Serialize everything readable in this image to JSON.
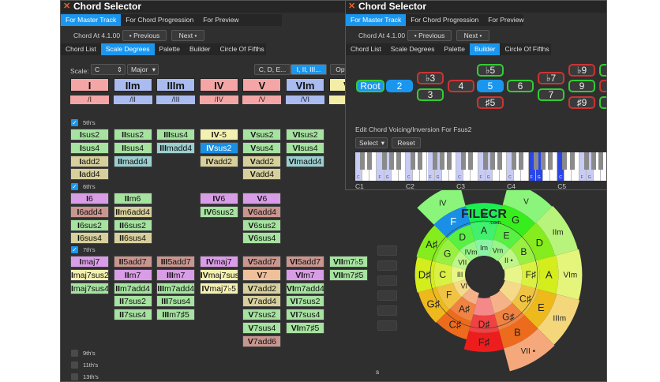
{
  "left_window": {
    "title": "Chord Selector",
    "top_tabs": [
      "For Master Track",
      "For Chord Progression",
      "For Preview"
    ],
    "chord_at": "Chord At 4.1.00",
    "previous": "• Previous",
    "next": "Next •",
    "sub_tabs": [
      "Chord List",
      "Scale Degrees",
      "Palette",
      "Builder",
      "Circle Of Fifths"
    ],
    "active_sub_tab": "Scale Degrees",
    "scale_label": "Scale:",
    "scale_key": "C",
    "scale_mode": "Major",
    "notation": [
      "C, D, E...",
      "I, II, III..."
    ],
    "options": "Opti",
    "degrees": [
      {
        "label": "I",
        "color": "#f4a6a6"
      },
      {
        "label": "IIm",
        "color": "#aabbf0"
      },
      {
        "label": "IIIm",
        "color": "#aabbf0"
      },
      {
        "label": "IV",
        "color": "#f4a6a6"
      },
      {
        "label": "V",
        "color": "#f4a6a6"
      },
      {
        "label": "VIm",
        "color": "#aabbf0"
      },
      {
        "label": "VI",
        "color": "#f2eea6"
      }
    ],
    "slash": [
      "/I",
      "/II",
      "/III",
      "/IV",
      "/V",
      "/VI",
      "/"
    ],
    "sections": [
      {
        "label": "5th's",
        "checked": true,
        "columns": [
          [
            [
              "I",
              "sus2",
              "g"
            ],
            [
              "I",
              "sus4",
              "g"
            ],
            [
              "I",
              "add2",
              "k"
            ],
            [
              "I",
              "add4",
              "k"
            ]
          ],
          [
            [
              "II",
              "sus2",
              "g"
            ],
            [
              "II",
              "sus4",
              "g"
            ],
            [
              "II",
              "madd4",
              "t"
            ]
          ],
          [
            [
              "III",
              "sus4",
              "g"
            ],
            [
              "III",
              "madd4",
              "t"
            ]
          ],
          [
            [
              "IV",
              "-5",
              "y"
            ],
            [
              "IV",
              "sus2",
              "s"
            ],
            [
              "IV",
              "add2",
              "k"
            ]
          ],
          [
            [
              "V",
              "sus2",
              "g"
            ],
            [
              "V",
              "sus4",
              "g"
            ],
            [
              "V",
              "add2",
              "k"
            ],
            [
              "V",
              "add4",
              "k"
            ]
          ],
          [
            [
              "VI",
              "sus2",
              "g"
            ],
            [
              "VI",
              "sus4",
              "g"
            ],
            [
              "VI",
              "madd4",
              "t"
            ]
          ],
          []
        ]
      },
      {
        "label": "6th's",
        "checked": true,
        "columns": [
          [
            [
              "I",
              "6",
              "p"
            ],
            [
              "I",
              "6add4",
              "b"
            ],
            [
              "I",
              "6sus2",
              "g"
            ],
            [
              "I",
              "6sus4",
              "k"
            ]
          ],
          [
            [
              "II",
              "m6",
              "g"
            ],
            [
              "II",
              "m6add4",
              "k"
            ],
            [
              "II",
              "6sus2",
              "g"
            ],
            [
              "II",
              "6sus4",
              "k"
            ]
          ],
          [],
          [
            [
              "IV",
              "6",
              "p"
            ],
            [
              "IV",
              "6sus2",
              "g"
            ]
          ],
          [
            [
              "V",
              "6",
              "p"
            ],
            [
              "V",
              "6add4",
              "b"
            ],
            [
              "V",
              "6sus2",
              "g"
            ],
            [
              "V",
              "6sus4",
              "g"
            ]
          ],
          [],
          []
        ]
      },
      {
        "label": "7th's",
        "checked": true,
        "columns": [
          [
            [
              "I",
              "maj7",
              "p"
            ],
            [
              "I",
              "maj7sus2",
              "y"
            ],
            [
              "I",
              "maj7sus4",
              "g"
            ]
          ],
          [
            [
              "II",
              "5add7",
              "b"
            ],
            [
              "II",
              "m7",
              "p"
            ],
            [
              "II",
              "m7add4",
              "g"
            ],
            [
              "II",
              "7sus2",
              "g"
            ],
            [
              "II",
              "7sus4",
              "g"
            ]
          ],
          [
            [
              "III",
              "5add7",
              "b"
            ],
            [
              "III",
              "m7",
              "p"
            ],
            [
              "III",
              "m7add4",
              "g"
            ],
            [
              "III",
              "7sus4",
              "g"
            ],
            [
              "III",
              "m7♯5",
              "g"
            ]
          ],
          [
            [
              "IV",
              "maj7",
              "p"
            ],
            [
              "IV",
              "maj7sus2",
              "y"
            ],
            [
              "IV",
              "maj7♭5",
              "y"
            ]
          ],
          [
            [
              "V",
              "5add7",
              "b"
            ],
            [
              "V",
              "7",
              "o"
            ],
            [
              "V",
              "7add2",
              "k"
            ],
            [
              "V",
              "7add4",
              "k"
            ],
            [
              "V",
              "7sus2",
              "g"
            ],
            [
              "V",
              "7sus4",
              "g"
            ],
            [
              "V",
              "7add6",
              "b"
            ]
          ],
          [
            [
              "VI",
              "5add7",
              "b"
            ],
            [
              "VI",
              "m7",
              "p"
            ],
            [
              "VI",
              "m7add4",
              "g"
            ],
            [
              "VI",
              "7sus2",
              "g"
            ],
            [
              "VI",
              "7sus4",
              "g"
            ],
            [
              "VI",
              "m7♯5",
              "g"
            ]
          ],
          [
            [
              "VII",
              "m7♭5",
              "g"
            ],
            [
              "VII",
              "m7♯5",
              "g"
            ]
          ]
        ]
      }
    ],
    "unchecked_sections": [
      "9th's",
      "11th's",
      "13th's"
    ],
    "cell_colors": {
      "g": "#a6e2a0",
      "k": "#d8d09c",
      "t": "#9ccfcf",
      "y": "#f4f0b0",
      "s": "#1a8fe6",
      "p": "#d99ce6",
      "b": "#c9968f",
      "o": "#f0c09a"
    },
    "footer_fragment": "s"
  },
  "right_window": {
    "title": "Chord Selector",
    "top_tabs": [
      "For Master Track",
      "For Chord Progression",
      "For Preview"
    ],
    "chord_at": "Chord At 4.1.00",
    "previous": "• Previous",
    "next": "Next •",
    "sub_tabs": [
      "Chord List",
      "Scale Degrees",
      "Palette",
      "Builder",
      "Circle Of Fifths"
    ],
    "active_sub_tab": "Builder",
    "intervals": [
      {
        "label": "Root",
        "state": "selected",
        "border": "#3c3"
      },
      {
        "label": "2",
        "state": "selected",
        "border": "#1a96ee"
      },
      {
        "label": "♭3",
        "border": "#c33"
      },
      {
        "label": "3",
        "border": "#3c3"
      },
      {
        "label": "4",
        "border": "#c33"
      },
      {
        "label": "♭5",
        "border": "#3c3"
      },
      {
        "label": "5",
        "state": "selected",
        "border": "#1a96ee"
      },
      {
        "label": "♯5",
        "border": "#c33"
      },
      {
        "label": "6",
        "border": "#3c3"
      },
      {
        "label": "♭7",
        "border": "#c33"
      },
      {
        "label": "7",
        "border": "#3c3"
      },
      {
        "label": "♭9",
        "border": "#c33"
      },
      {
        "label": "9",
        "border": "#3c3"
      },
      {
        "label": "♯9",
        "border": "#c33"
      }
    ],
    "voicing_label": "Edit Chord Voicing/Inversion For Fsus2",
    "select": "Select",
    "reset": "Reset",
    "octave_labels": [
      "C1",
      "C2",
      "C3",
      "C4",
      "C5"
    ],
    "key_note_labels": [
      "C",
      "F",
      "G"
    ],
    "active_notes": [
      "F4",
      "G4",
      "C5"
    ]
  },
  "circle_of_fifths": {
    "major": [
      "C",
      "G",
      "D",
      "A",
      "E",
      "B",
      "F♯",
      "C♯",
      "G♯",
      "D♯",
      "A♯",
      "F"
    ],
    "minor": [
      "A",
      "E",
      "B",
      "F♯",
      "C♯",
      "G♯",
      "D♯",
      "A♯",
      "F",
      "C",
      "G",
      "D"
    ],
    "inner_degrees": [
      "Im",
      "Vm",
      "II •",
      "",
      "",
      "",
      "",
      "",
      "VI",
      "III",
      "VII",
      "IVm"
    ],
    "outer_degrees": [
      "",
      "V",
      "IIm",
      "VIm",
      "IIIm",
      "VII •",
      "",
      "",
      "",
      "",
      "",
      "IV"
    ],
    "selected": "F",
    "selected_color": "#1a8fe6",
    "watermark": "FILECR",
    "watermark_sub": ".com"
  }
}
